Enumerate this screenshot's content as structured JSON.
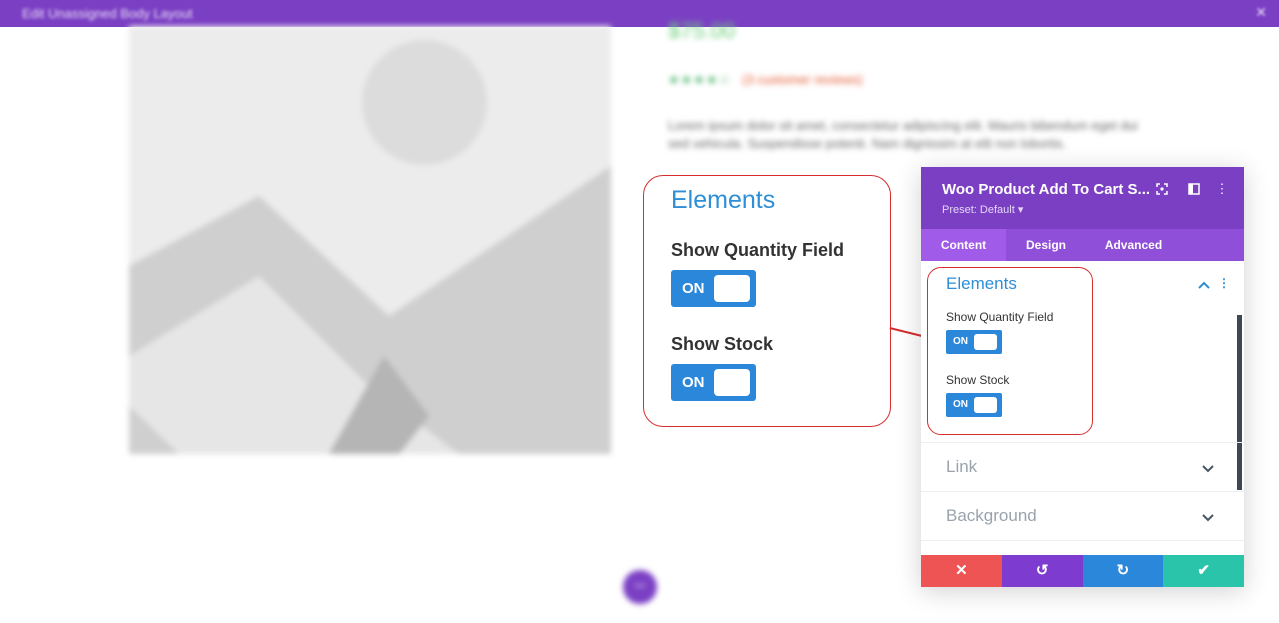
{
  "window": {
    "title": "Edit Unassigned Body Layout",
    "close_icon": "close-icon"
  },
  "product": {
    "price": "$75.00",
    "stars": "★★★★☆",
    "reviews": "(3 customer reviews)",
    "description": "Lorem ipsum dolor sit amet, consectetur adipiscing elit. Mauris bibendum eget dui sed vehicula. Suspendisse potenti. Nam dignissim at elit non lobortis."
  },
  "callout": {
    "title": "Elements",
    "fields": [
      {
        "label": "Show Quantity Field",
        "toggle": "ON"
      },
      {
        "label": "Show Stock",
        "toggle": "ON"
      }
    ]
  },
  "panel": {
    "title": "Woo Product Add To Cart S...",
    "preset": "Preset: Default ▾",
    "tabs": [
      {
        "label": "Content",
        "active": true
      },
      {
        "label": "Design",
        "active": false
      },
      {
        "label": "Advanced",
        "active": false
      }
    ],
    "sections": {
      "elements": {
        "title": "Elements",
        "fields": [
          {
            "label": "Show Quantity Field",
            "toggle": "ON"
          },
          {
            "label": "Show Stock",
            "toggle": "ON"
          }
        ]
      },
      "link": {
        "title": "Link"
      },
      "background": {
        "title": "Background"
      }
    },
    "actions": {
      "cancel": "✕",
      "undo": "↺",
      "redo": "↻",
      "save": "✔"
    }
  },
  "colors": {
    "purple": "#7b3fc4",
    "tab_bar": "#8f4fd8",
    "blue": "#2b87da",
    "cancel": "#ef5455",
    "undo": "#7e3bd0",
    "redo": "#2b87da",
    "save": "#29c4a9",
    "highlight": "#d62e2e"
  }
}
